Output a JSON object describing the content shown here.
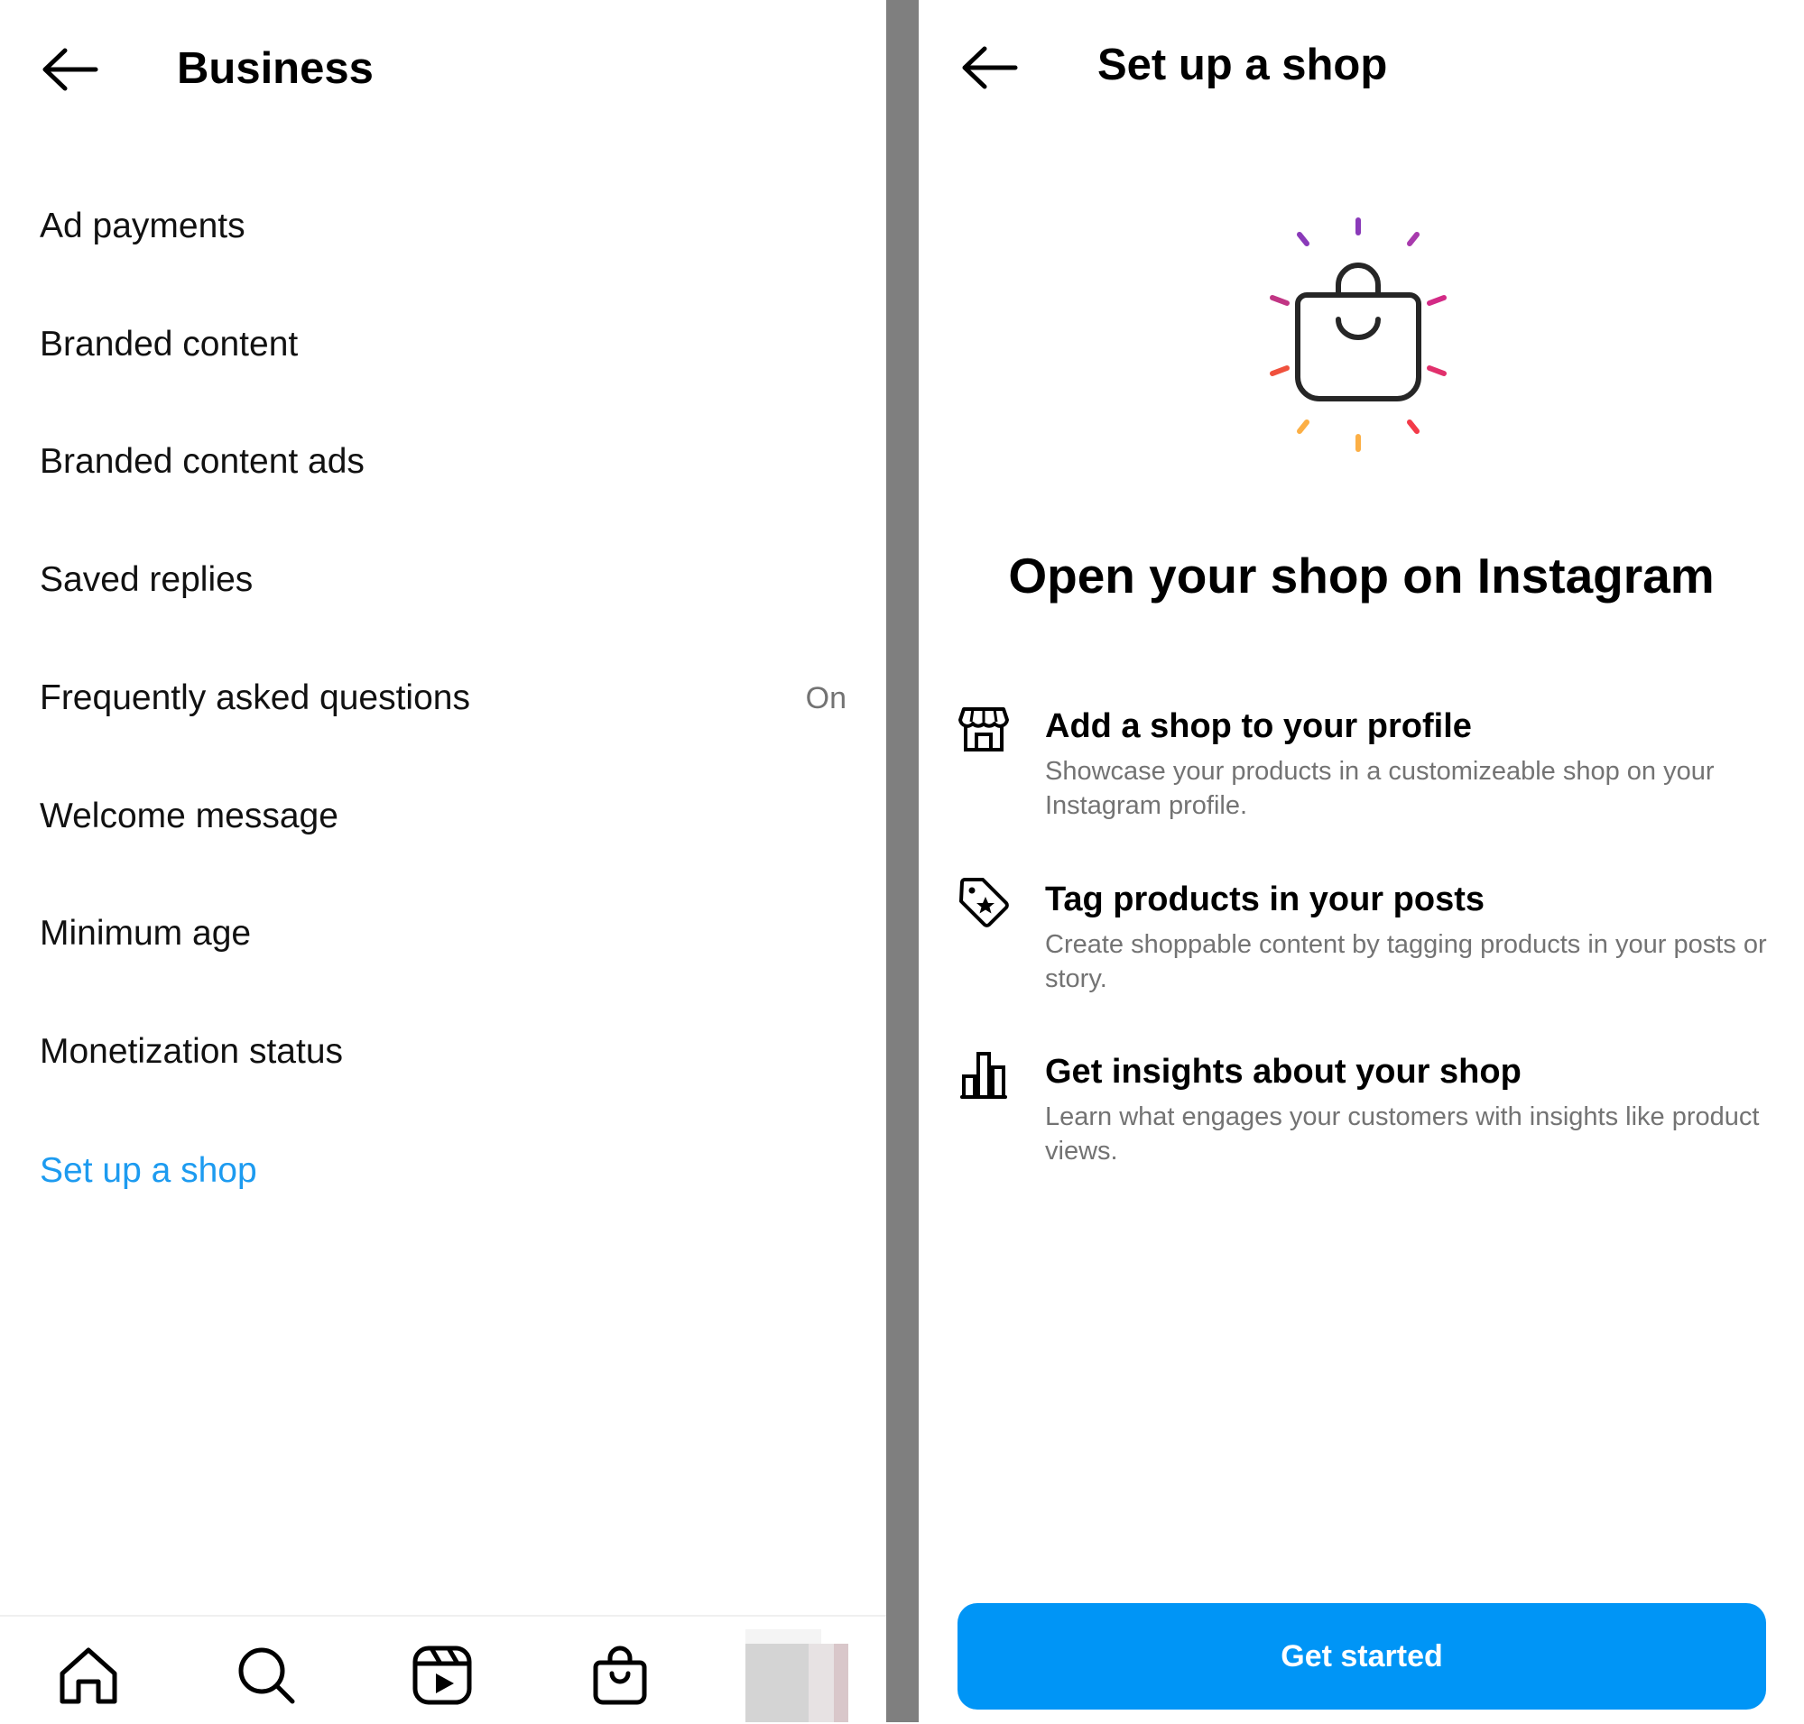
{
  "left_panel": {
    "header": {
      "title": "Business"
    },
    "menu": {
      "items": [
        {
          "label": "Ad payments",
          "value": ""
        },
        {
          "label": "Branded content",
          "value": ""
        },
        {
          "label": "Branded content ads",
          "value": ""
        },
        {
          "label": "Saved replies",
          "value": ""
        },
        {
          "label": "Frequently asked questions",
          "value": "On"
        },
        {
          "label": "Welcome message",
          "value": ""
        },
        {
          "label": "Minimum age",
          "value": ""
        },
        {
          "label": "Monetization status",
          "value": ""
        },
        {
          "label": "Set up a shop",
          "value": ""
        }
      ]
    },
    "bottom_nav": {
      "items": [
        {
          "icon": "home-icon"
        },
        {
          "icon": "search-icon"
        },
        {
          "icon": "reels-icon"
        },
        {
          "icon": "shop-bag-icon"
        },
        {
          "icon": "profile-avatar"
        }
      ]
    }
  },
  "right_panel": {
    "header": {
      "title": "Set up a shop"
    },
    "hero": {
      "icon": "shopping-bag-sparkle-icon",
      "title": "Open your shop on Instagram"
    },
    "features": [
      {
        "icon": "storefront-icon",
        "title": "Add a shop to your profile",
        "description": "Showcase your products in a customizeable shop on your Instagram profile."
      },
      {
        "icon": "product-tag-icon",
        "title": "Tag products in your posts",
        "description": "Create shoppable content by tagging products in your posts or story."
      },
      {
        "icon": "bar-chart-icon",
        "title": "Get insights about your shop",
        "description": "Learn what engages your customers with insights like product views."
      }
    ],
    "cta": {
      "label": "Get started"
    }
  },
  "colors": {
    "link_blue": "#1d9bf0",
    "button_blue": "#0095f6",
    "secondary_text": "#737373",
    "divider_gray": "#7f7f7f",
    "sparkle_gradient": [
      "#8a3ab9",
      "#c13584",
      "#e1306c",
      "#fd1d1d",
      "#f77737",
      "#fcaf45"
    ]
  }
}
